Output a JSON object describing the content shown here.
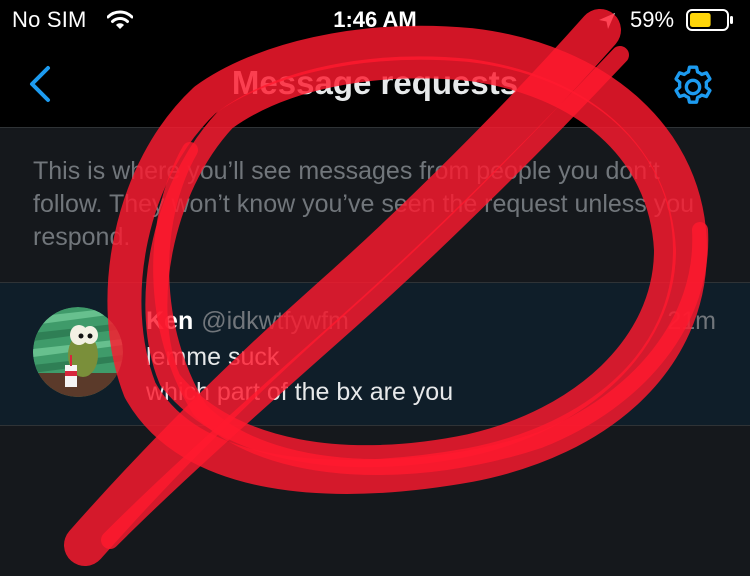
{
  "status_bar": {
    "carrier": "No SIM",
    "time": "1:46 AM",
    "battery_percent": "59%",
    "battery_level": 0.59,
    "icons": [
      "wifi-icon",
      "location-arrow-icon",
      "battery-icon"
    ]
  },
  "nav": {
    "back_icon": "chevron-left-icon",
    "title": "Message requests",
    "settings_icon": "gear-icon"
  },
  "info": {
    "text": "This is where you’ll see messages from people you don’t follow. They won’t know you’ve seen the request unless you respond."
  },
  "requests": [
    {
      "name": "Ken",
      "handle": "@idkwtfywfm",
      "time": "21m",
      "line1": "lemme suck",
      "line2": "which part of the bx are you"
    }
  ],
  "colors": {
    "background": "#15181c",
    "header_background": "#000000",
    "accent_blue": "#1d9bf0",
    "row_highlight": "#0f1e29",
    "muted_text": "#71767b",
    "scribble_red": "#ff1a2e"
  }
}
